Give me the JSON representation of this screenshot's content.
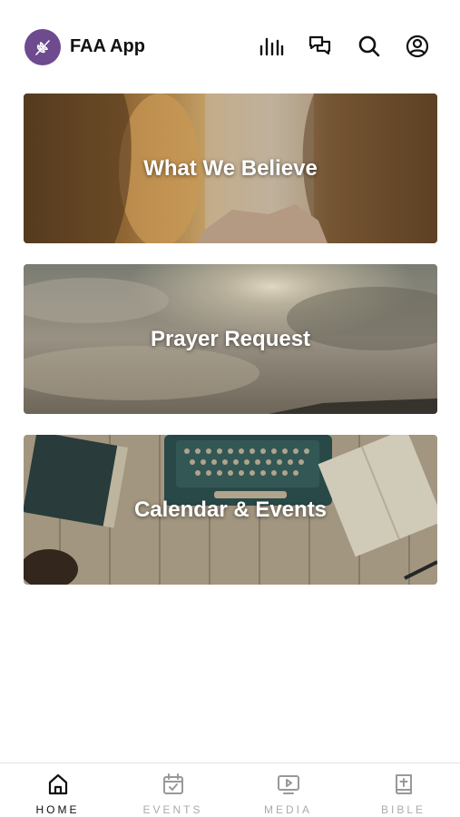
{
  "app": {
    "title": "FAA App",
    "logo_icon": "wheat-icon",
    "brand_color": "#6e4a8e"
  },
  "header_icons": [
    "bar-chart-icon",
    "chat-icon",
    "search-icon",
    "profile-icon"
  ],
  "cards": [
    {
      "title": "What We Believe"
    },
    {
      "title": "Prayer Request"
    },
    {
      "title": "Calendar & Events"
    }
  ],
  "tabs": [
    {
      "label": "HOME",
      "icon": "home-icon",
      "active": true
    },
    {
      "label": "EVENTS",
      "icon": "calendar-icon",
      "active": false
    },
    {
      "label": "MEDIA",
      "icon": "video-icon",
      "active": false
    },
    {
      "label": "BIBLE",
      "icon": "bible-icon",
      "active": false
    }
  ]
}
